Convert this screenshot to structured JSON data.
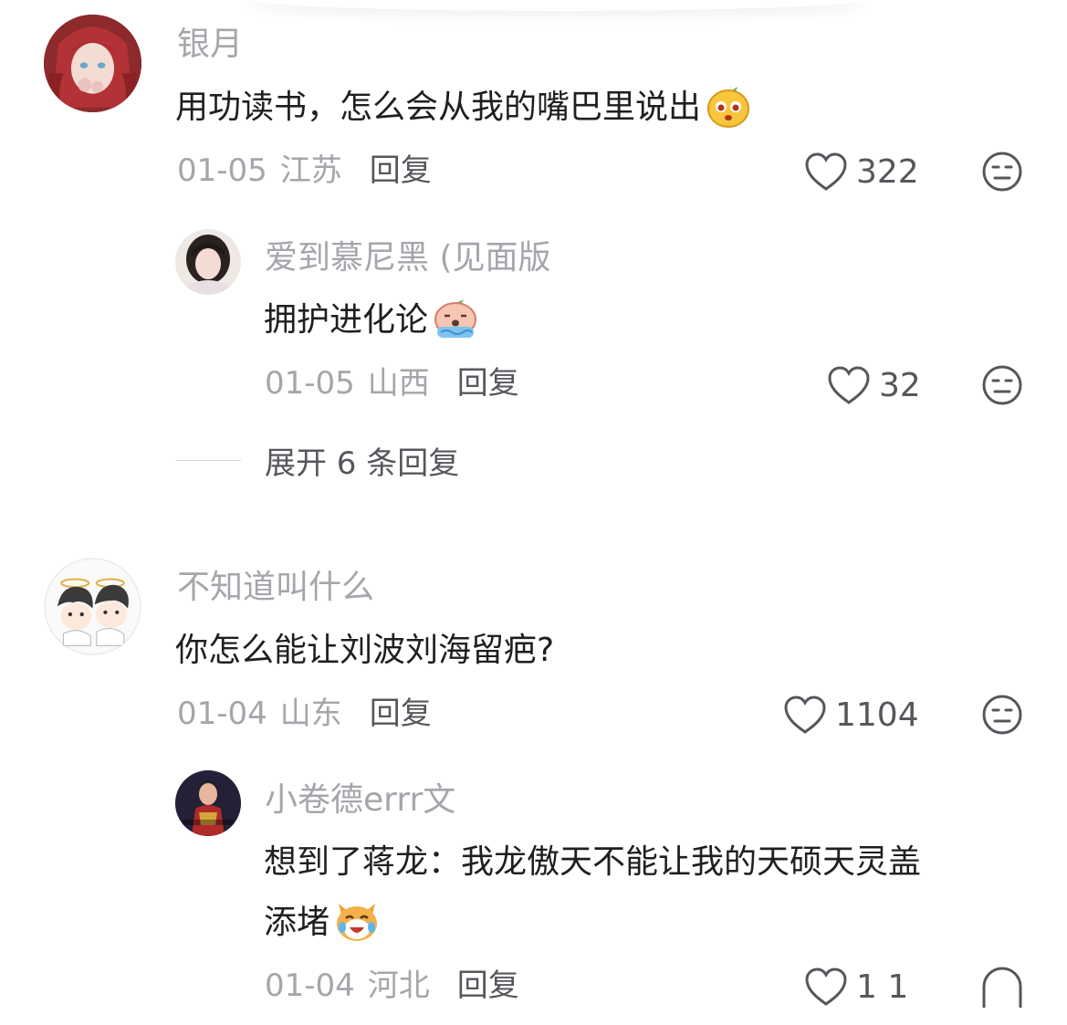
{
  "colors": {
    "meta_gray": "#a4a6ab",
    "text_dark": "#1f1f1f",
    "action_gray": "#55575c"
  },
  "comments": [
    {
      "username": "银月",
      "avatar": "red-haired-anime-girl-avatar",
      "text": "用功读书，怎么会从我的嘴巴里说出",
      "emoji": "yellow-fruit-emoji",
      "date": "01-05",
      "location": "江苏",
      "reply_label": "回复",
      "likes": "322",
      "reply": {
        "username": "爱到慕尼黑 (见面版",
        "avatar": "girl-photo-avatar",
        "text": "拥护进化论",
        "emoji": "crying-peach-emoji",
        "date": "01-05",
        "location": "山西",
        "reply_label": "回复",
        "likes": "32"
      },
      "expand_label": "展开 6 条回复"
    },
    {
      "username": "不知道叫什么",
      "avatar": "cartoon-couple-avatar",
      "text": "你怎么能让刘波刘海留疤?",
      "date": "01-04",
      "location": "山东",
      "reply_label": "回复",
      "likes": "1104",
      "reply": {
        "username": "小卷德errr文",
        "avatar": "red-costume-man-avatar",
        "text_line1": "想到了蒋龙：我龙傲天不能让我的天硕天灵盖",
        "text_line2": "添堵",
        "emoji": "laughing-cat-emoji",
        "date": "01-04",
        "location": "河北",
        "reply_label": "回复",
        "likes": "1 1"
      }
    }
  ]
}
